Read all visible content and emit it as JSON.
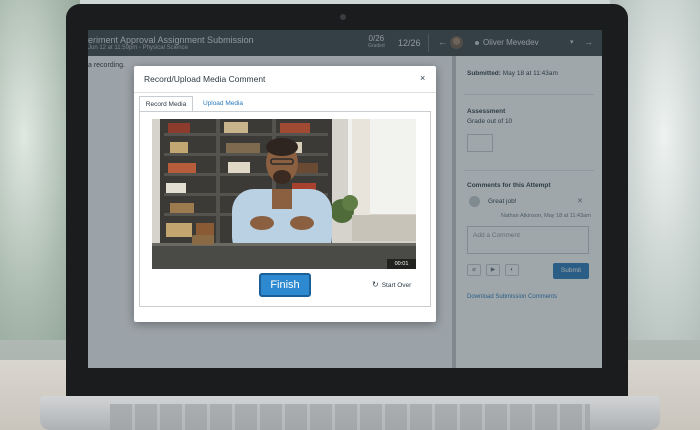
{
  "header": {
    "assignment_title": "eriment Approval Assignment Submission",
    "assignment_subtitle": "Jun 12 at 11:59pm - Physical Science",
    "graded_count": "0/26",
    "graded_label": "Graded",
    "student_index": "12/26",
    "student_name": "Oliver Mevedev"
  },
  "left_pane": {
    "text": "a recording."
  },
  "right_pane": {
    "submitted_label": "Submitted:",
    "submitted_value": "May 18 at 11:43am",
    "assessment_label": "Assessment",
    "grade_out_of": "Grade out of 10",
    "comments_heading": "Comments for this Attempt",
    "comment_text": "Great job!",
    "comment_author": "Nathan Atkinson, May 18 at 11:43am",
    "comment_placeholder": "Add a Comment",
    "submit_label": "Submit",
    "download_link": "Download Submission Comments"
  },
  "modal": {
    "title": "Record/Upload Media Comment",
    "close_symbol": "×",
    "tabs": [
      {
        "label": "Record Media",
        "active": true
      },
      {
        "label": "Upload Media",
        "active": false
      }
    ],
    "recording_time": "00:01",
    "finish_label": "Finish",
    "start_over_label": "Start Over",
    "start_over_icon": "↻"
  },
  "colors": {
    "accent": "#2b7abc",
    "topbar": "#3d4348",
    "finish": "#2d8ad0"
  }
}
